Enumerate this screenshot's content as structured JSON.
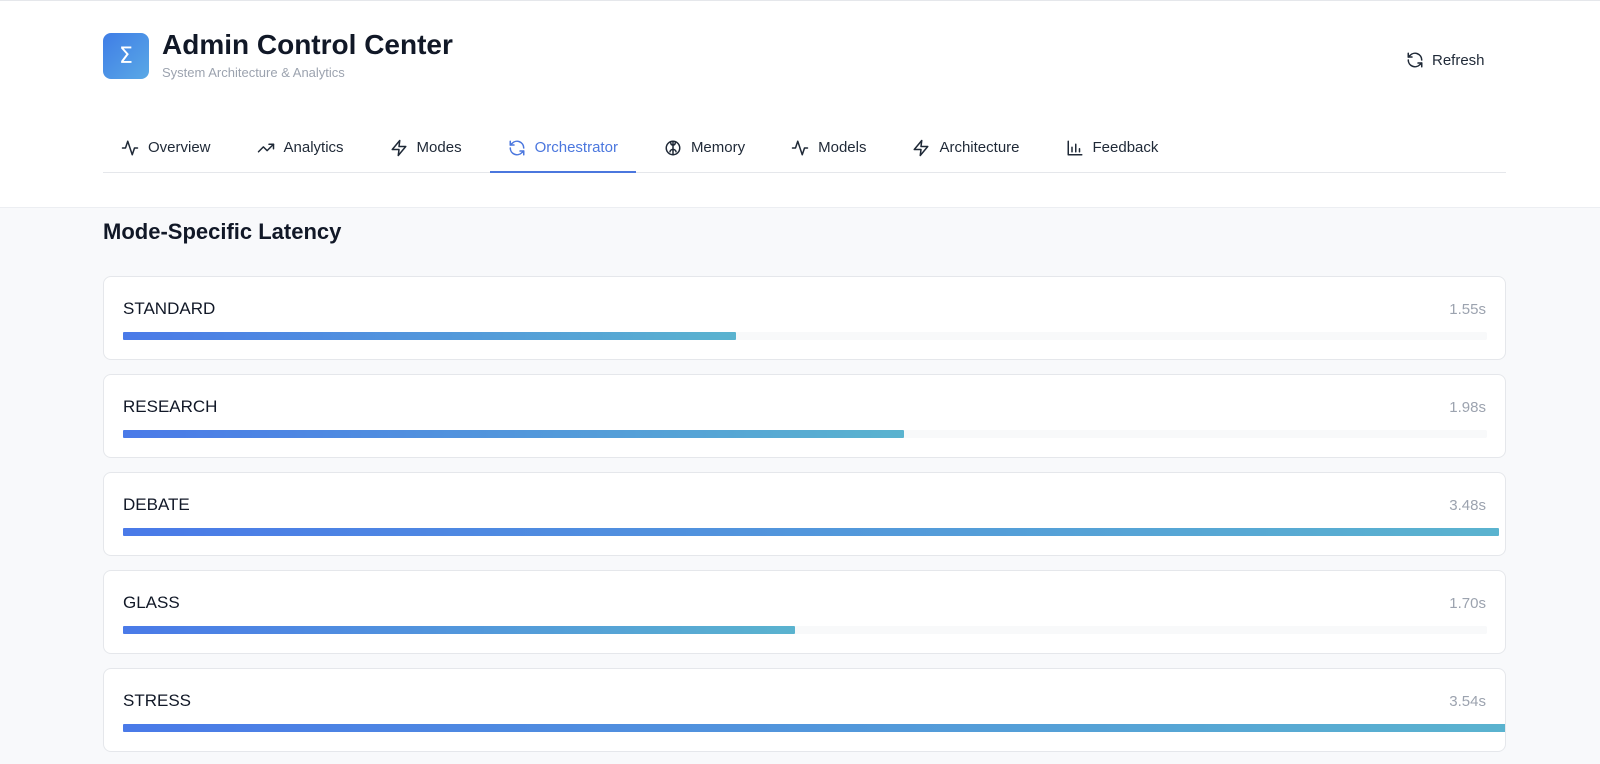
{
  "app": {
    "logo_glyph": "Σ",
    "title": "Admin Control Center",
    "subtitle": "System Architecture & Analytics",
    "refresh_label": "Refresh"
  },
  "tabs": [
    {
      "label": "Overview",
      "icon": "activity-icon",
      "active": false
    },
    {
      "label": "Analytics",
      "icon": "trending-up-icon",
      "active": false
    },
    {
      "label": "Modes",
      "icon": "zap-icon",
      "active": false
    },
    {
      "label": "Orchestrator",
      "icon": "refresh-icon",
      "active": true
    },
    {
      "label": "Memory",
      "icon": "brain-icon",
      "active": false
    },
    {
      "label": "Models",
      "icon": "activity-icon",
      "active": false
    },
    {
      "label": "Architecture",
      "icon": "zap-icon",
      "active": false
    },
    {
      "label": "Feedback",
      "icon": "bar-chart-icon",
      "active": false
    }
  ],
  "section": {
    "title": "Mode-Specific Latency"
  },
  "latency": [
    {
      "mode": "STANDARD",
      "value_label": "1.55s",
      "fill_fraction": 0.443
    },
    {
      "mode": "RESEARCH",
      "value_label": "1.98s",
      "fill_fraction": 0.565
    },
    {
      "mode": "DEBATE",
      "value_label": "3.48s",
      "fill_fraction": 0.995
    },
    {
      "mode": "GLASS",
      "value_label": "1.70s",
      "fill_fraction": 0.486
    },
    {
      "mode": "STRESS",
      "value_label": "3.54s",
      "fill_fraction": 1.0
    }
  ],
  "colors": {
    "accent": "#4b77de",
    "bar_start": "#4a7ae8",
    "bar_end": "#5ab3cf"
  }
}
